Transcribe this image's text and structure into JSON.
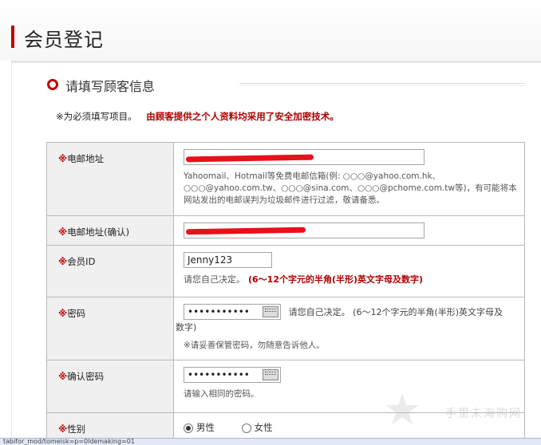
{
  "page": {
    "title": "会员登记"
  },
  "section": {
    "title": "请填写顾客信息"
  },
  "notice": {
    "required_note": "※为必须填写项目。",
    "security_note": "由顾客提供之个人资料均采用了安全加密技术。"
  },
  "fields": {
    "email": {
      "star": "※",
      "label": "电邮地址",
      "hint": "Yahoomail、Hotmail等免费电邮信箱(例: ○○○@yahoo.com.hk、○○○@yahoo.com.tw、○○○@sina.com、○○○@pchome.com.tw等)，有可能将本网站发出的电邮误判为垃圾邮件进行过滤，敬请备悉。"
    },
    "email_confirm": {
      "star": "※",
      "label": "电邮地址(确认)"
    },
    "member_id": {
      "star": "※",
      "label": "会员ID",
      "value": "Jenny123",
      "hint": "请您自己决定。",
      "rule": "(6～12个字元的半角(半形)英文字母及数字)"
    },
    "password": {
      "star": "※",
      "label": "密码",
      "value": "•••••••••••",
      "hint": "请您自己决定。 (6～12个字元的半角(半形)英文字母及",
      "hint_cont": "数字)",
      "note": "※请妥善保管密码，勿随意告诉他人。"
    },
    "password_confirm": {
      "star": "※",
      "label": "确认密码",
      "value": "•••••••••••",
      "hint": "请输入相同的密码。"
    },
    "gender": {
      "star": "※",
      "label": "性别",
      "options": [
        "男性",
        "女性"
      ],
      "selected": "男性"
    }
  },
  "watermark": {
    "text": "手里未海购网"
  },
  "statusbar": {
    "text": "tabifor_mod/tomeisk=p=0ldemaking=01"
  },
  "colors": {
    "accent": "#c00000",
    "label_bg": "#f0f0f0",
    "border": "#b9b9b9"
  }
}
